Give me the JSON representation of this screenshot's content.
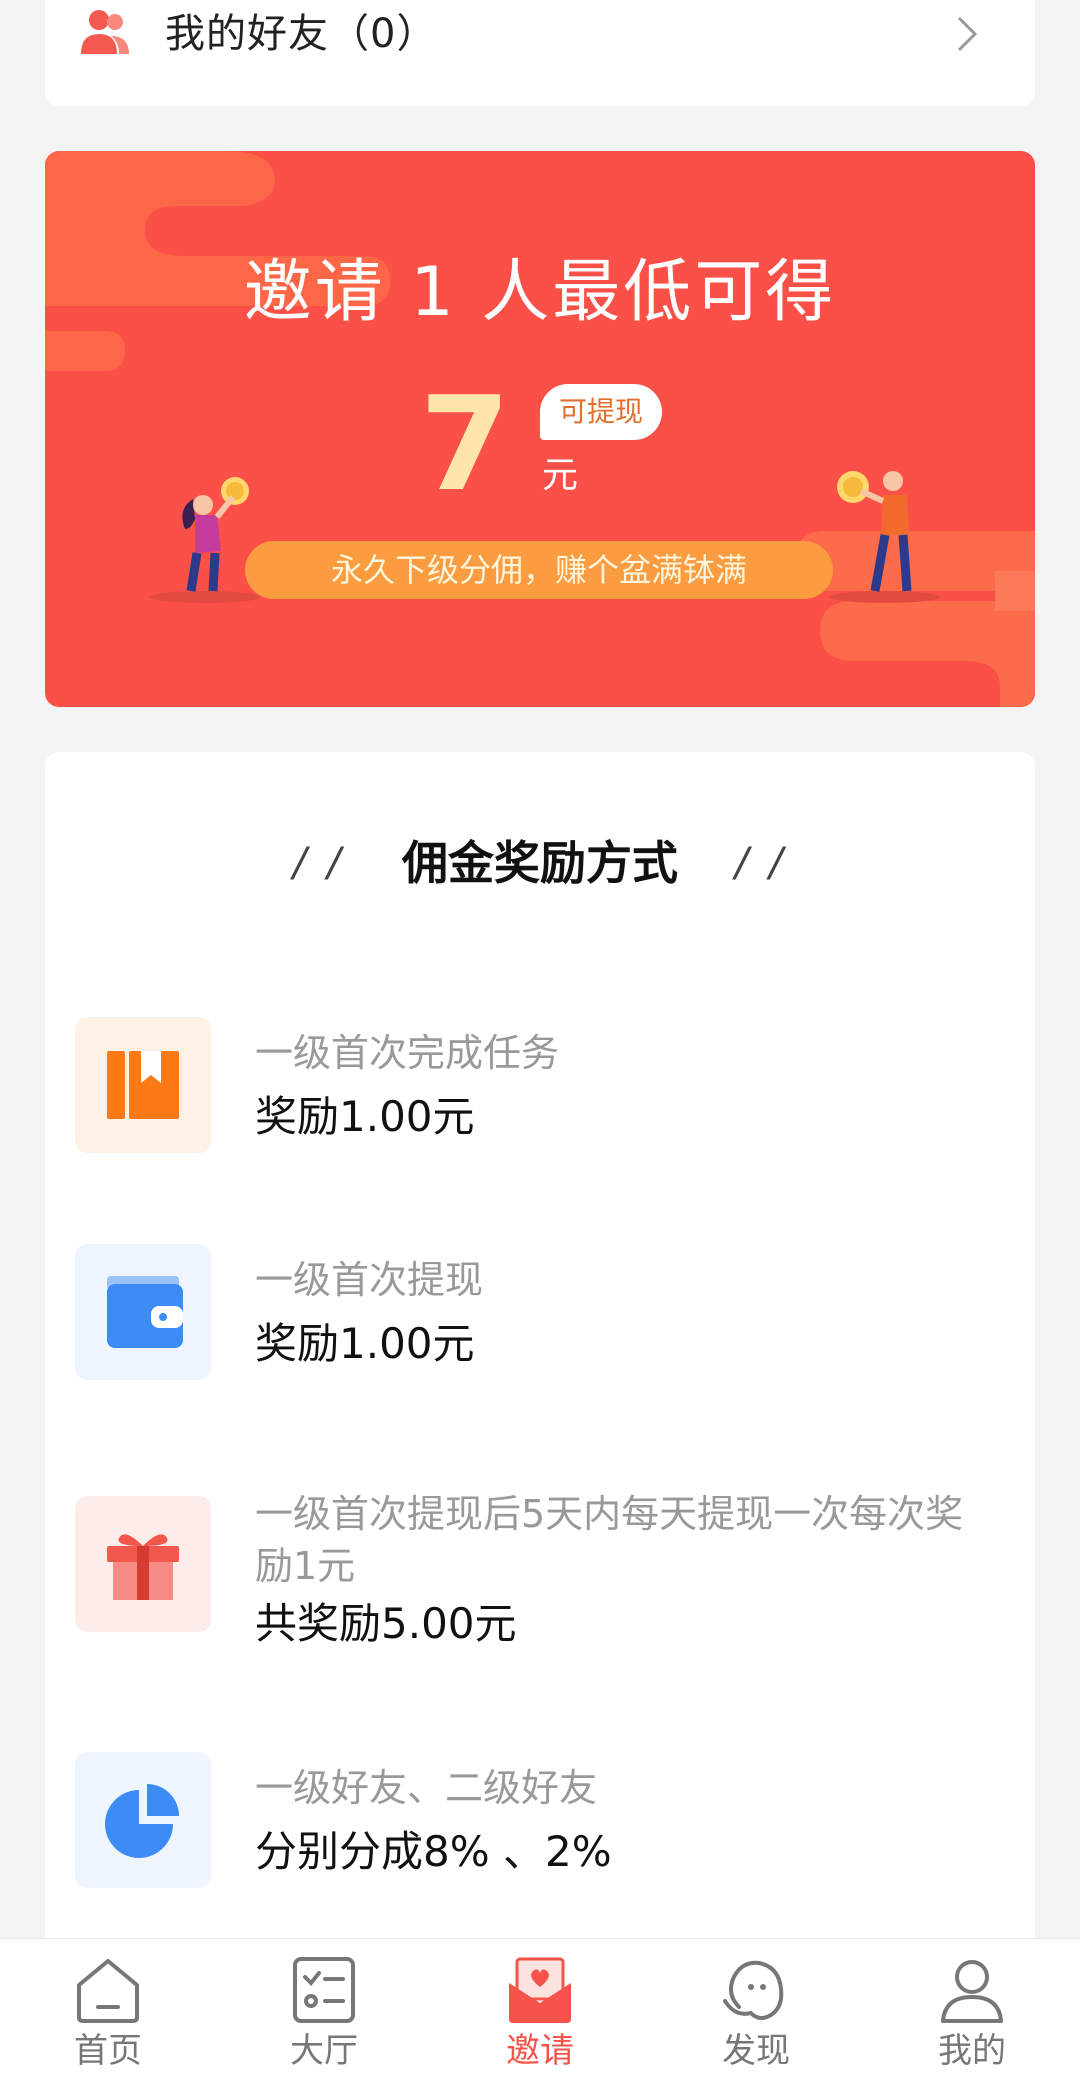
{
  "friends": {
    "label": "我的好友（0）"
  },
  "banner": {
    "title": "邀请 1 人最低可得",
    "amount": "7",
    "badge": "可提现",
    "unit": "元",
    "slogan": "永久下级分佣，赚个盆满钵满"
  },
  "commission": {
    "title": "佣金奖励方式",
    "quote_left": "/ /",
    "quote_right": "/ /",
    "items": [
      {
        "icon": "bookmark-icon",
        "desc": "一级首次完成任务",
        "reward": "奖励1.00元",
        "color": "#fb7a16"
      },
      {
        "icon": "wallet-icon",
        "desc": "一级首次提现",
        "reward": "奖励1.00元",
        "color": "#3d8cf5"
      },
      {
        "icon": "gift-icon",
        "desc": "一级首次提现后5天内每天提现一次每次奖励1元",
        "reward": "共奖励5.00元",
        "color": "#f2574d"
      },
      {
        "icon": "pie-chart-icon",
        "desc": "一级好友、二级好友",
        "reward": "分别分成8% 、2%",
        "color": "#3d8cf5"
      }
    ]
  },
  "tabbar": {
    "active": "邀请",
    "tabs": [
      {
        "label": "首页",
        "icon": "home-icon"
      },
      {
        "label": "大厅",
        "icon": "task-list-icon"
      },
      {
        "label": "邀请",
        "icon": "invite-envelope-icon"
      },
      {
        "label": "发现",
        "icon": "ghost-icon"
      },
      {
        "label": "我的",
        "icon": "person-icon"
      }
    ]
  }
}
